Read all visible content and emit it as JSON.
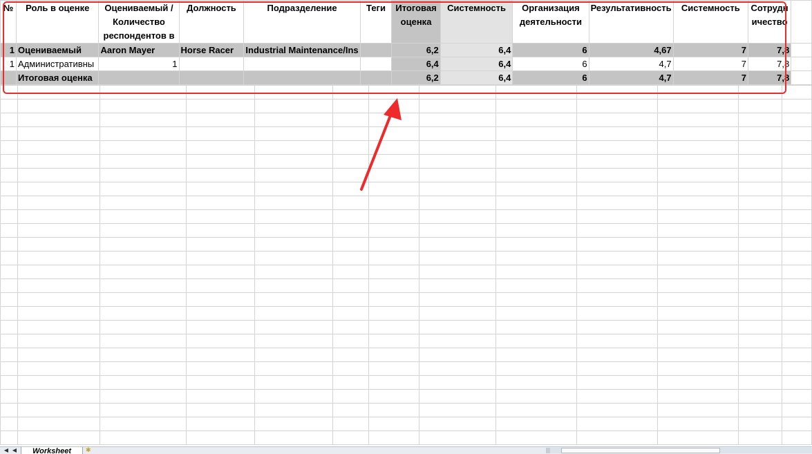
{
  "headers": {
    "num": "№",
    "role": "Роль в оценке",
    "evaluated": "Оцениваемый / Количество респондентов в",
    "position": "Должность",
    "department": "Подразделение",
    "tags": "Теги",
    "final": "Итоговая оценка",
    "system1": "Системность",
    "org": "Организация деятельности",
    "results": "Результативность",
    "system2": "Системность",
    "employee": "Сотрудн ичество"
  },
  "rows": [
    {
      "num": "1",
      "role": "Оцениваемый",
      "evaluated": "Aaron Mayer",
      "position": "Horse Racer",
      "department": "Industrial Maintenance/Ins",
      "tags": "",
      "final": "6,2",
      "system1": "6,4",
      "org": "6",
      "results": "4,67",
      "system2": "7",
      "employee": "7,8"
    },
    {
      "num": "1",
      "role": "Административны",
      "evaluated": "1",
      "position": "",
      "department": "",
      "tags": "",
      "final": "6,4",
      "system1": "6,4",
      "org": "6",
      "results": "4,7",
      "system2": "7",
      "employee": "7,8"
    },
    {
      "num": "",
      "role": "Итоговая оценка",
      "evaluated": "",
      "position": "",
      "department": "",
      "tags": "",
      "final": "6,2",
      "system1": "6,4",
      "org": "6",
      "results": "4,7",
      "system2": "7",
      "employee": "7,8"
    }
  ],
  "sheet_tab": "Worksheet",
  "nav_first": "◀",
  "nav_prev": "◀",
  "colors": {
    "highlight": "#ee2a2a",
    "gray_dark": "#c4c4c4",
    "gray_light": "#e3e3e3",
    "gridline": "#d4d4d4"
  }
}
